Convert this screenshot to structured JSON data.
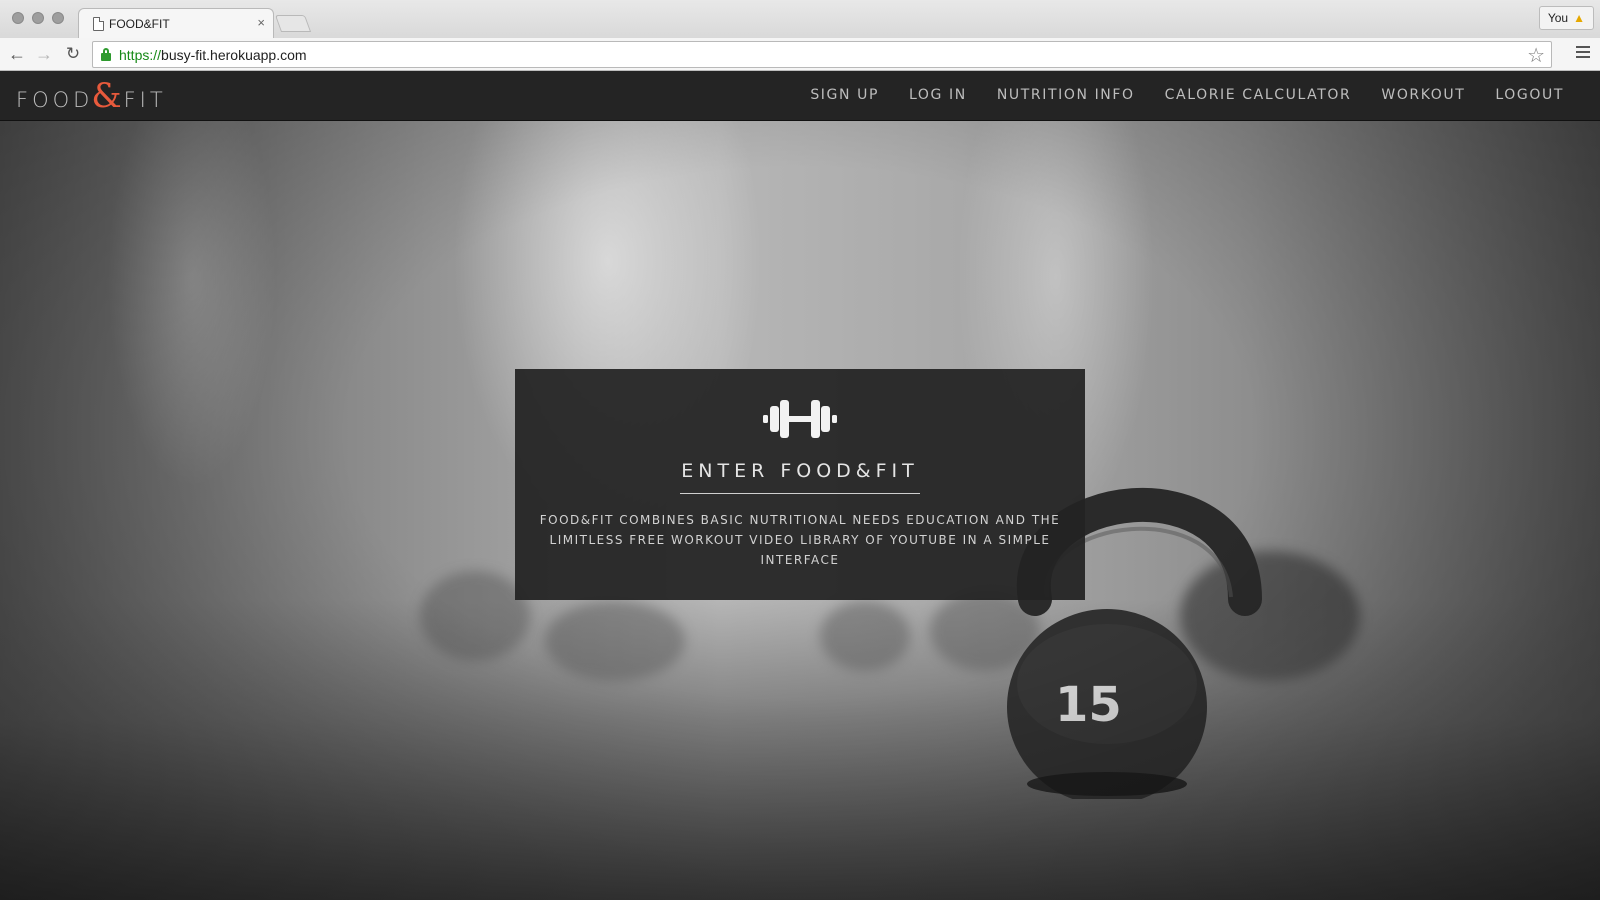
{
  "browser": {
    "tab_title": "FOOD&FIT",
    "tab_close": "×",
    "url_scheme": "https://",
    "url_host": "busy-fit.herokuapp.com",
    "user_label": "You",
    "warning_icon": "warning-icon"
  },
  "site": {
    "logo_left": "FOOD",
    "logo_amp": "&",
    "logo_right": "FIT",
    "brand_accent": "#e85a3c",
    "nav": [
      "SIGN UP",
      "LOG IN",
      "NUTRITION INFO",
      "CALORIE CALCULATOR",
      "WORKOUT",
      "LOGOUT"
    ]
  },
  "hero": {
    "icon": "dumbbell-icon",
    "title": "ENTER FOOD&FIT",
    "description": "FOOD&FIT COMBINES BASIC NUTRITIONAL NEEDS EDUCATION AND THE LIMITLESS FREE WORKOUT VIDEO LIBRARY OF YOUTUBE IN A SIMPLE INTERFACE",
    "kettlebell_number": "15"
  }
}
